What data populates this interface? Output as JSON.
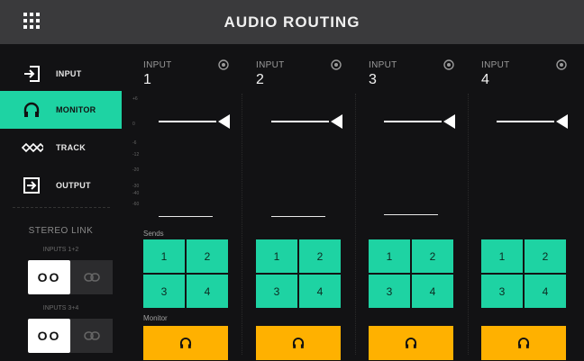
{
  "header": {
    "title": "AUDIO ROUTING",
    "menu_icon": "grid-menu-icon"
  },
  "sidebar": {
    "items": [
      {
        "label": "INPUT",
        "icon": "input-arrow-icon",
        "active": false
      },
      {
        "label": "MONITOR",
        "icon": "headphones-icon",
        "active": true
      },
      {
        "label": "TRACK",
        "icon": "track-wave-icon",
        "active": false
      },
      {
        "label": "OUTPUT",
        "icon": "output-arrow-icon",
        "active": false
      }
    ],
    "stereo_link": {
      "title": "STEREO LINK",
      "pairs": [
        {
          "label": "INPUTS 1+2",
          "on_label": "OO",
          "off_icon": "link-icon"
        },
        {
          "label": "INPUTS 3+4",
          "on_label": "OO",
          "off_icon": "link-icon"
        }
      ]
    }
  },
  "scale_labels": [
    "+6",
    "0",
    "-6",
    "-12",
    "-20",
    "-30",
    "-40",
    "-60"
  ],
  "sends_label": "Sends",
  "monitor_label": "Monitor",
  "channels": [
    {
      "label": "INPUT",
      "number": "1",
      "icon": "gain-knob-icon",
      "sends": [
        "1",
        "2",
        "3",
        "4"
      ]
    },
    {
      "label": "INPUT",
      "number": "2",
      "icon": "gain-knob-icon",
      "sends": [
        "1",
        "2",
        "3",
        "4"
      ]
    },
    {
      "label": "INPUT",
      "number": "3",
      "icon": "gain-knob-icon",
      "sends": [
        "1",
        "2",
        "3",
        "4"
      ]
    },
    {
      "label": "INPUT",
      "number": "4",
      "icon": "gain-knob-icon",
      "sends": [
        "1",
        "2",
        "3",
        "4"
      ]
    }
  ],
  "colors": {
    "accent": "#1ed3a3",
    "monitor": "#ffb100",
    "header": "#3a3a3c",
    "background": "#121214"
  }
}
